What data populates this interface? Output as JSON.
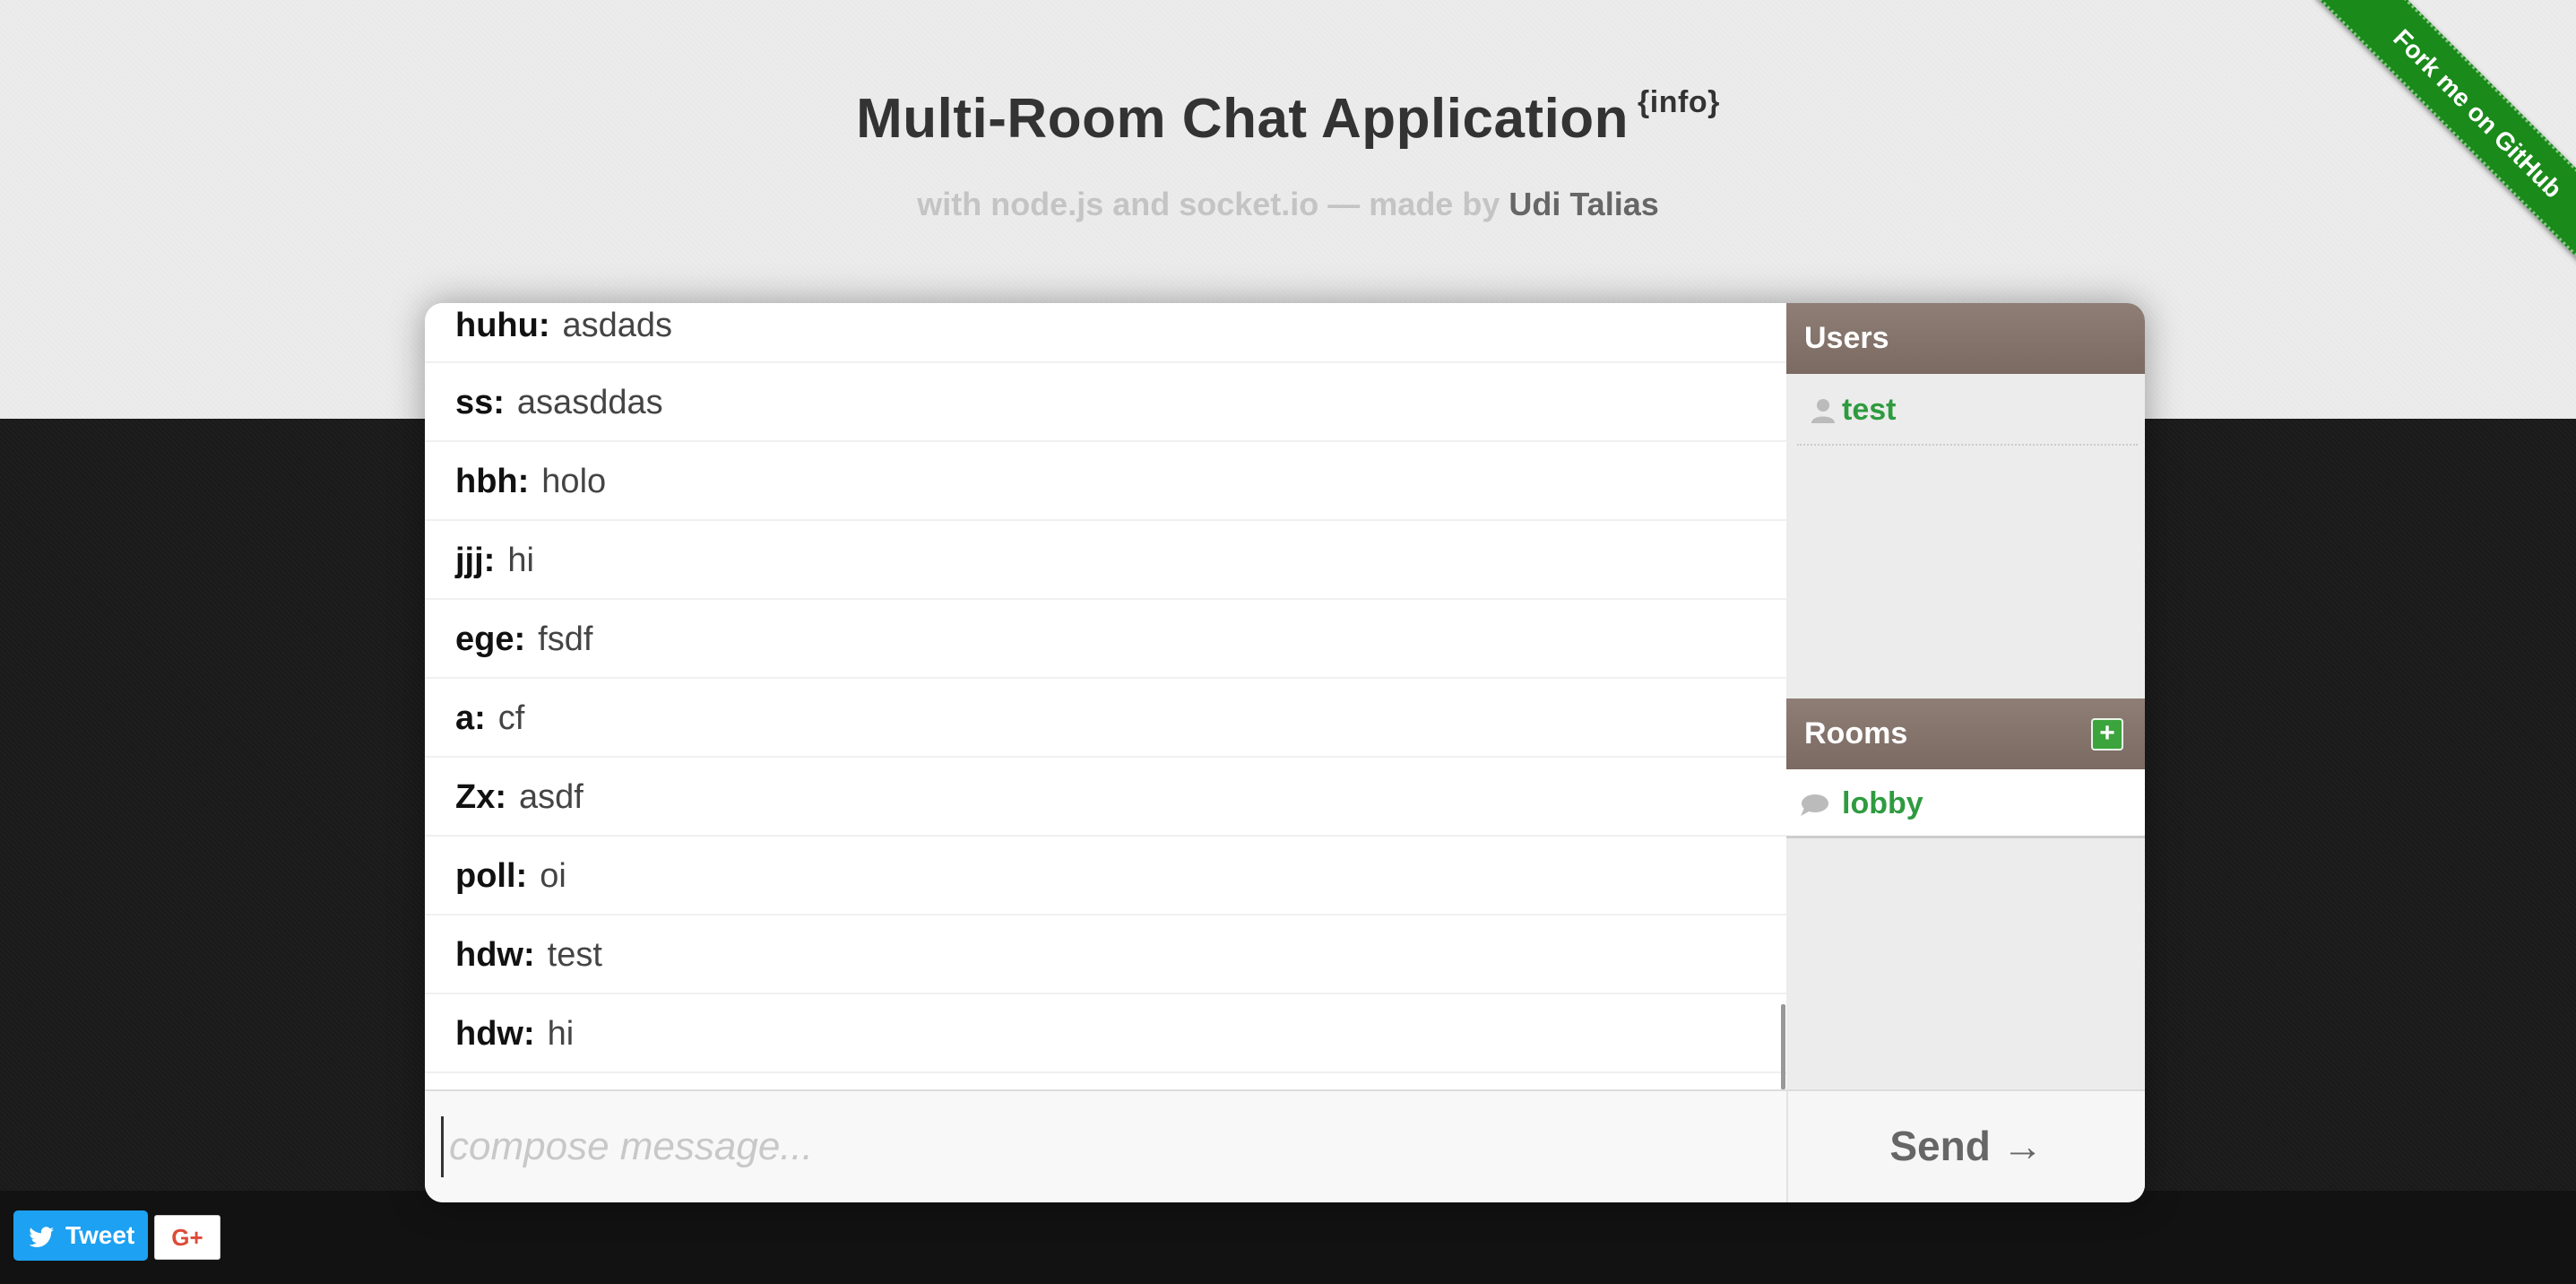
{
  "header": {
    "title": "Multi-Room Chat Application",
    "info_link": "{info}",
    "subtitle_prefix": "with node.js and socket.io — made by",
    "author": "Udi Talias"
  },
  "ribbon": {
    "label": "Fork me on GitHub",
    "color": "#1a8a1a"
  },
  "messages": [
    {
      "user": "huhu:",
      "text": "asdads"
    },
    {
      "user": "ss:",
      "text": "asasddas"
    },
    {
      "user": "hbh:",
      "text": "holo"
    },
    {
      "user": "jjj:",
      "text": "hi"
    },
    {
      "user": "ege:",
      "text": "fsdf"
    },
    {
      "user": "a:",
      "text": "cf"
    },
    {
      "user": "Zx:",
      "text": "asdf"
    },
    {
      "user": "poll:",
      "text": "oi"
    },
    {
      "user": "hdw:",
      "text": "test"
    },
    {
      "user": "hdw:",
      "text": "hi"
    }
  ],
  "sidebar": {
    "users_title": "Users",
    "users": [
      {
        "name": "test",
        "icon": "user-icon"
      }
    ],
    "rooms_title": "Rooms",
    "add_room_label": "+",
    "rooms": [
      {
        "name": "lobby",
        "icon": "chat-bubble-icon"
      }
    ]
  },
  "compose": {
    "placeholder": "compose message...",
    "value": "",
    "send_label": "Send →"
  },
  "social": {
    "tweet_label": "Tweet",
    "gplus_label": "G+"
  },
  "colors": {
    "accent_green": "#2e9b3f",
    "panel_header": "#857570",
    "twitter_blue": "#1da1f2"
  }
}
